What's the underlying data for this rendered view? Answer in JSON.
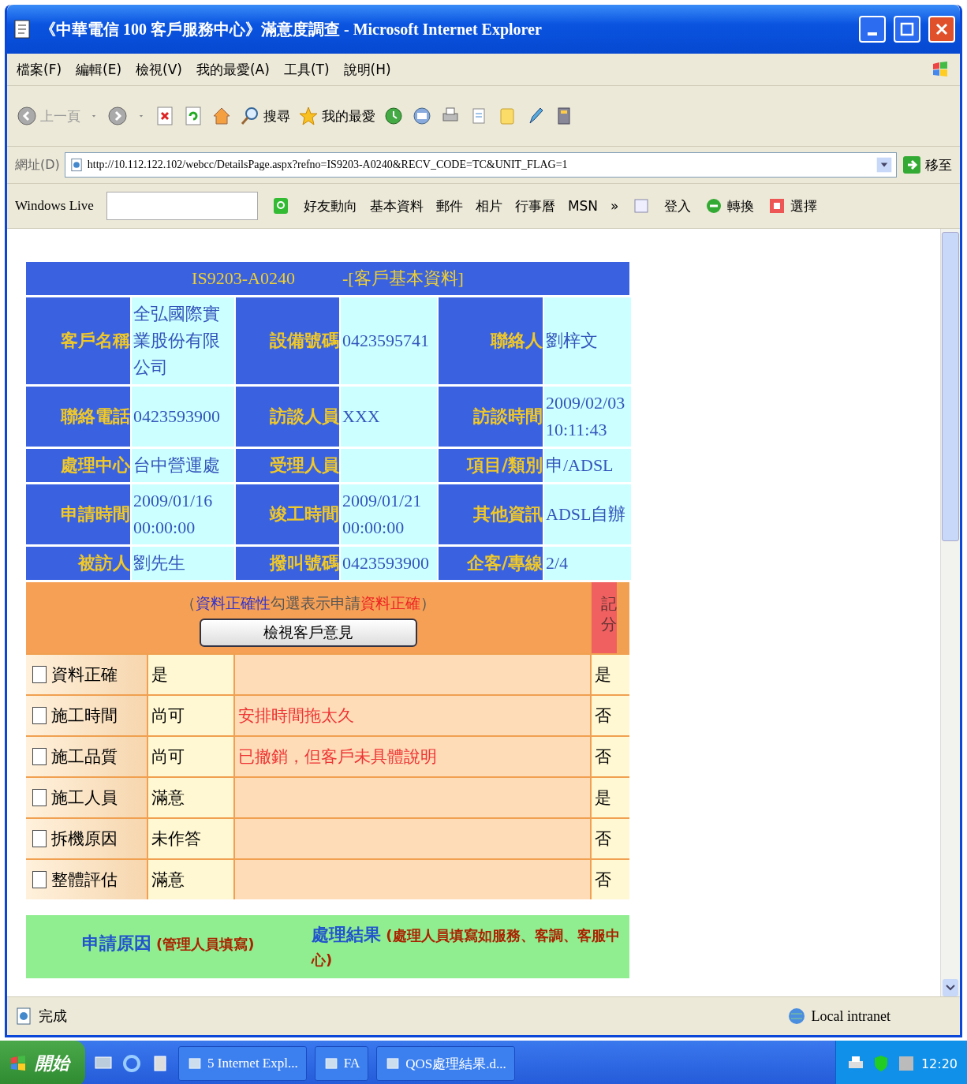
{
  "window": {
    "title": "《中華電信 100 客戶服務中心》滿意度調查 - Microsoft Internet Explorer"
  },
  "menu": [
    "檔案(F)",
    "編輯(E)",
    "檢視(V)",
    "我的最愛(A)",
    "工具(T)",
    "說明(H)"
  ],
  "toolbar": {
    "back": "上一頁",
    "search": "搜尋",
    "favorites": "我的最愛"
  },
  "address": {
    "label": "網址(D)",
    "url": "http://10.112.122.102/webcc/DetailsPage.aspx?refno=IS9203-A0240&RECV_CODE=TC&UNIT_FLAG=1",
    "go": "移至"
  },
  "links_bar": {
    "brand": "Windows Live",
    "items": [
      "好友動向",
      "基本資料",
      "郵件",
      "相片",
      "行事曆",
      "MSN"
    ],
    "more": "»",
    "signin": "登入",
    "translate": "轉換",
    "select": "選擇"
  },
  "record": {
    "code": "IS9203-A0240",
    "title": "-[客戶基本資料]",
    "rows": [
      [
        {
          "label": "客戶名稱",
          "value": "全弘國際實業股份有限公司"
        },
        {
          "label": "設備號碼",
          "value": "0423595741"
        },
        {
          "label": "聯絡人",
          "value": "劉梓文"
        }
      ],
      [
        {
          "label": "聯絡電話",
          "value": "0423593900"
        },
        {
          "label": "訪談人員",
          "value": "XXX"
        },
        {
          "label": "訪談時間",
          "value": "2009/02/03 10:11:43"
        }
      ],
      [
        {
          "label": "處理中心",
          "value": "台中營運處"
        },
        {
          "label": "受理人員"
        },
        {
          "label": "項目/類別",
          "value": "申/ADSL"
        }
      ],
      [
        {
          "label": "申請時間",
          "value": "2009/01/16 00:00:00"
        },
        {
          "label": "竣工時間",
          "value": "2009/01/21 00:00:00"
        },
        {
          "label": "其他資訊",
          "value": "ADSL自辦"
        }
      ],
      [
        {
          "label": "被訪人",
          "value": "劉先生"
        },
        {
          "label": "撥叫號碼",
          "value": "0423593900"
        },
        {
          "label": "企客/專線",
          "value": "2/4"
        }
      ]
    ]
  },
  "survey": {
    "note": [
      {
        "text": "（",
        "color": "#555555"
      },
      {
        "text": "資料正確性",
        "color": "#3333cc"
      },
      {
        "text": "勾選表示申請",
        "color": "#555555"
      },
      {
        "text": "資料正確",
        "color": "#ee2222"
      },
      {
        "text": "）",
        "color": "#555555"
      }
    ],
    "button": "檢視客戶意見",
    "score_header": "記分",
    "rows": [
      {
        "label": "資料正確",
        "checked": false,
        "answer": "是",
        "score": "是"
      },
      {
        "label": "施工時間",
        "checked": false,
        "answer": "尚可",
        "comment": "安排時間拖太久",
        "score": "否"
      },
      {
        "label": "施工品質",
        "checked": false,
        "answer": "尚可",
        "comment": "已撤銷，但客戶未具體說明",
        "score": "否"
      },
      {
        "label": "施工人員",
        "checked": false,
        "answer": "滿意",
        "score": "是"
      },
      {
        "label": "拆機原因",
        "checked": false,
        "answer": "未作答",
        "score": "否"
      },
      {
        "label": "整體評估",
        "checked": false,
        "answer": "滿意",
        "score": "否"
      }
    ]
  },
  "footer": [
    {
      "title": "申請原因",
      "hint": "(管理人員填寫)"
    },
    {
      "title": "處理結果",
      "hint": "(處理人員填寫如服務、客調、客服中心)"
    }
  ],
  "status": {
    "text": "完成",
    "zone": "Local intranet"
  },
  "taskbar": {
    "start": "開始",
    "tasks": [
      "5 Internet Expl...",
      "FA",
      "QOS處理結果.d..."
    ],
    "clock": "12:20"
  }
}
